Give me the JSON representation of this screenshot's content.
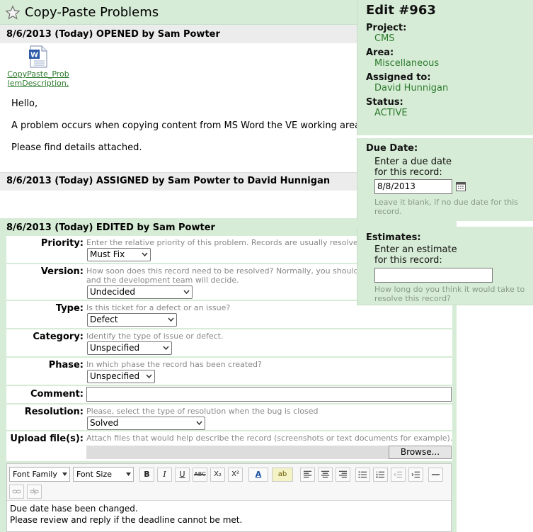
{
  "title": "Copy-Paste Problems",
  "events": [
    {
      "header": "8/6/2013 (Today) OPENED by Sam Powter"
    },
    {
      "header": "8/6/2013 (Today) ASSIGNED by Sam Powter to David Hunnigan"
    },
    {
      "header": "8/6/2013 (Today) EDITED by Sam Powter"
    }
  ],
  "attachment": {
    "line1": "CopyPaste_Prob",
    "line2": "lemDescription.",
    "icon": "word-doc-icon"
  },
  "message": {
    "line1": "Hello,",
    "line2": "A problem occurs when copying content from MS Word the VE working area.",
    "line3": "Please find details attached."
  },
  "form": {
    "priority": {
      "label": "Priority:",
      "hint": "Enter the relative priority of this problem. Records are usually resolve",
      "value": "Must Fix"
    },
    "version": {
      "label": "Version:",
      "hint1": "How soon does this record need to be resolved? Normally, you should",
      "hint2": "and the development team will decide.",
      "value": "Undecided"
    },
    "type": {
      "label": "Type:",
      "hint": "Is this ticket for a defect or an issue?",
      "value": "Defect"
    },
    "category": {
      "label": "Category:",
      "hint": "Identify the type of issue or defect.",
      "value": "Unspecified"
    },
    "phase": {
      "label": "Phase:",
      "hint": "In which phase the record has been created?",
      "value": "Unspecified"
    },
    "comment": {
      "label": "Comment:",
      "value": ""
    },
    "resolution": {
      "label": "Resolution:",
      "hint": "Please, select the type of resolution when the bug is closed",
      "value": "Solved"
    },
    "upload": {
      "label": "Upload file(s):",
      "hint": "Attach files that would help describe the record (screenshots or text documents for example).",
      "browse": "Browse..."
    }
  },
  "editor": {
    "font_family": "Font Family",
    "font_size": "Font Size",
    "buttons": [
      "B",
      "I",
      "U",
      "ABC",
      "X₂",
      "X²",
      "A",
      "ab"
    ],
    "text_line1": "Due date hase been changed.",
    "text_line2": "Please review and reply if the deadline cannot be met."
  },
  "panel": {
    "title": "Edit #963",
    "project_label": "Project:",
    "project": "CMS",
    "area_label": "Area:",
    "area": "Miscellaneous",
    "assigned_label": "Assigned to:",
    "assigned": "David Hunnigan",
    "status_label": "Status:",
    "status": "ACTIVE",
    "due_label": "Due Date:",
    "due_text1": "Enter a due date",
    "due_text2": "for this record:",
    "due_value": "8/8/2013",
    "due_hint1": "Leave it blank, if no due date for this",
    "due_hint2": "record.",
    "est_label": "Estimates:",
    "est_text1": "Enter an estimate",
    "est_text2": "for this record:",
    "est_value": "",
    "est_hint1": "How long do you think it would take to",
    "est_hint2": "resolve this record?"
  },
  "colors": {
    "panel_bg": "#d6ecd6",
    "link_green": "#2d7a2d",
    "hint_grey": "#888888"
  }
}
